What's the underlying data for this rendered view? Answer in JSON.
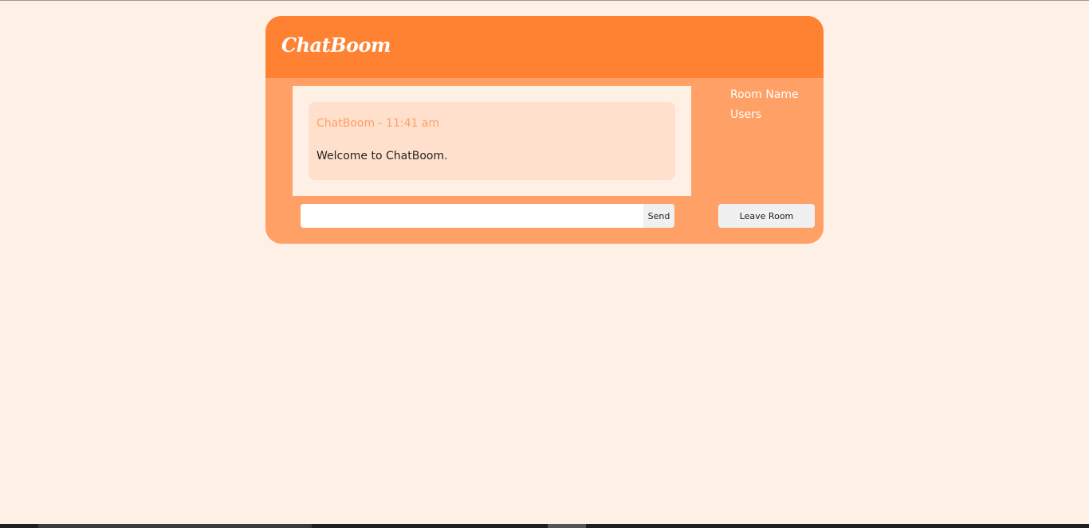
{
  "app": {
    "logo_text": "ChatBoom"
  },
  "messages": [
    {
      "meta": "ChatBoom - 11:41 am",
      "text": "Welcome to ChatBoom."
    }
  ],
  "sidebar": {
    "room_label": "Room Name",
    "users_label": "Users"
  },
  "composer": {
    "input_value": "",
    "send_label": "Send"
  },
  "actions": {
    "leave_label": "Leave Room"
  },
  "colors": {
    "page_background": "#fff0e6",
    "header": "#ff8233",
    "card": "#ffa066",
    "message_bubble": "#ffe0cc",
    "message_meta": "#ff9f66",
    "button": "#f0f0f0"
  }
}
